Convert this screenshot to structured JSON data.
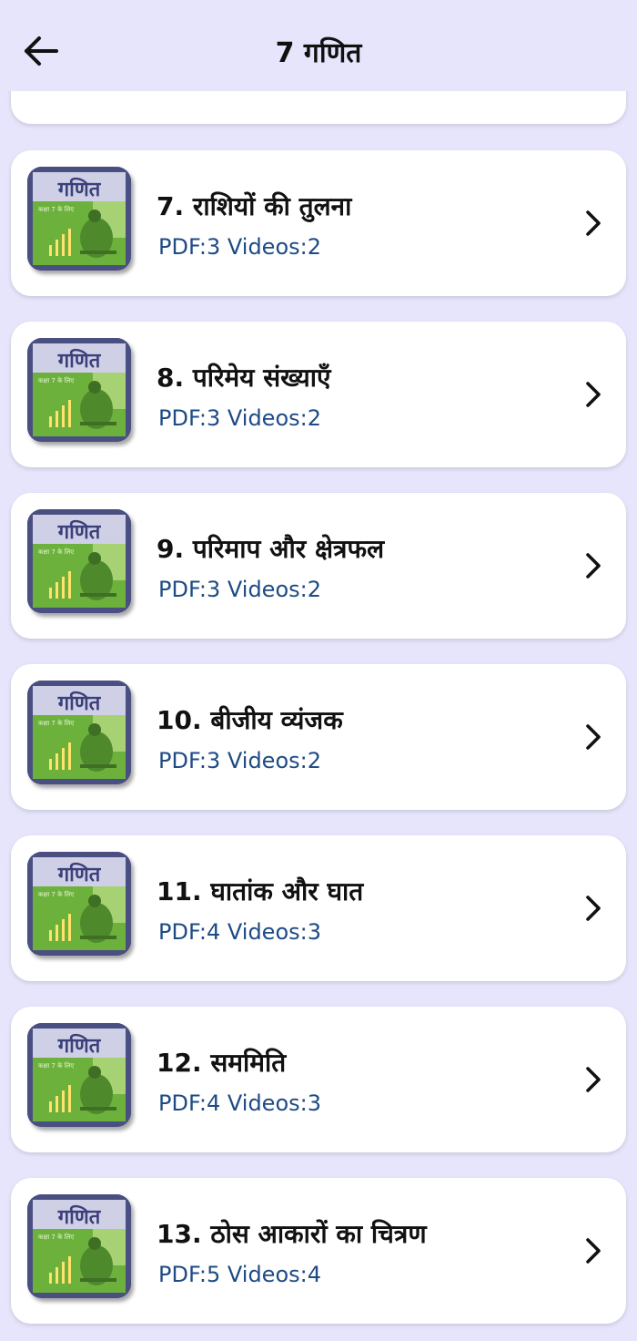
{
  "header": {
    "title": "7 गणित",
    "back_icon": "arrow-left-icon"
  },
  "thumbnail": {
    "label": "गणित",
    "sublabel": "कक्षा 7 के लिए",
    "icon": "book-cover-icon",
    "colors": {
      "frame": "#4a4f82",
      "label_bg": "#cfd0e6",
      "label_text": "#3b3f7a",
      "green": "#6cb13c",
      "light": "#a6d274"
    }
  },
  "chapters": [
    {
      "title": "7. राशियों की तुलना",
      "meta": "PDF:3 Videos:2"
    },
    {
      "title": "8. परिमेय संख्याएँ",
      "meta": "PDF:3 Videos:2"
    },
    {
      "title": "9. परिमाप और क्षेत्रफल",
      "meta": "PDF:3 Videos:2"
    },
    {
      "title": "10. बीजीय व्यंजक",
      "meta": "PDF:3 Videos:2"
    },
    {
      "title": "11. घातांक और घात",
      "meta": "PDF:4 Videos:3"
    },
    {
      "title": "12. सममिति",
      "meta": "PDF:4 Videos:3"
    },
    {
      "title": "13. ठोस आकारों का चित्रण",
      "meta": "PDF:5 Videos:4"
    }
  ],
  "colors": {
    "background": "#e6e5fb",
    "card": "#ffffff",
    "meta_text": "#1e4b85",
    "title_text": "#111111"
  }
}
